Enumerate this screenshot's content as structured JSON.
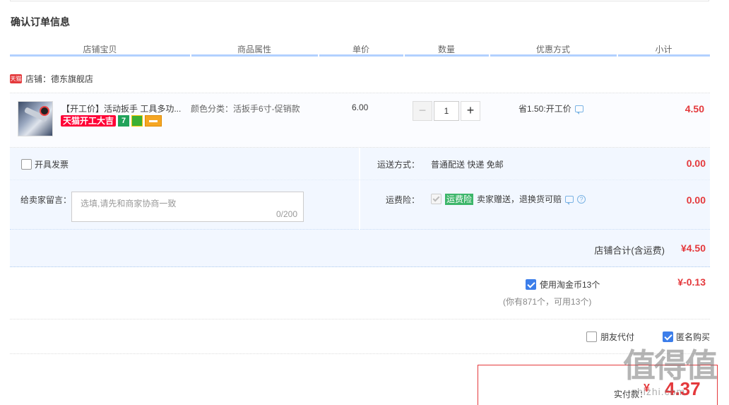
{
  "section_title": "确认订单信息",
  "columns": [
    "店铺宝贝",
    "商品属性",
    "单价",
    "数量",
    "优惠方式",
    "小计"
  ],
  "shop": {
    "badge": "天猫",
    "label": "店铺：德东旗舰店"
  },
  "item": {
    "title": "【开工价】活动扳手 工具多功...",
    "promo_tag": "天猫开工大吉",
    "tag7": "7",
    "attribute": "颜色分类：活扳手6寸-促销款",
    "unit_price": "6.00",
    "quantity": "1",
    "minus": "−",
    "plus": "+",
    "discount": "省1.50:开工价",
    "subtotal": "4.50"
  },
  "invoice": {
    "label": "开具发票"
  },
  "message": {
    "label": "给卖家留言：",
    "placeholder": "选填,请先和商家协商一致",
    "count": "0/200"
  },
  "shipping": {
    "label": "运送方式：",
    "value": "普通配送 快递 免邮",
    "price": "0.00"
  },
  "insurance": {
    "label": "运费险：",
    "badge": "运费险",
    "text": "卖家赠送，退换货可赔",
    "help": "?",
    "price": "0.00"
  },
  "shop_total": {
    "label": "店铺合计(含运费)",
    "value": "¥4.50"
  },
  "coins": {
    "label": "使用淘金币13个",
    "sub": "(你有871个，可用13个)",
    "value": "¥-0.13",
    "checked": true
  },
  "friend_pay": {
    "label": "朋友代付",
    "checked": false
  },
  "anonymous": {
    "label": "匿名购买",
    "checked": true
  },
  "payment": {
    "label": "实付款：",
    "currency": "¥",
    "value": "4.37"
  },
  "watermark": {
    "text": "值得值",
    "url": "zhizhi.com"
  }
}
